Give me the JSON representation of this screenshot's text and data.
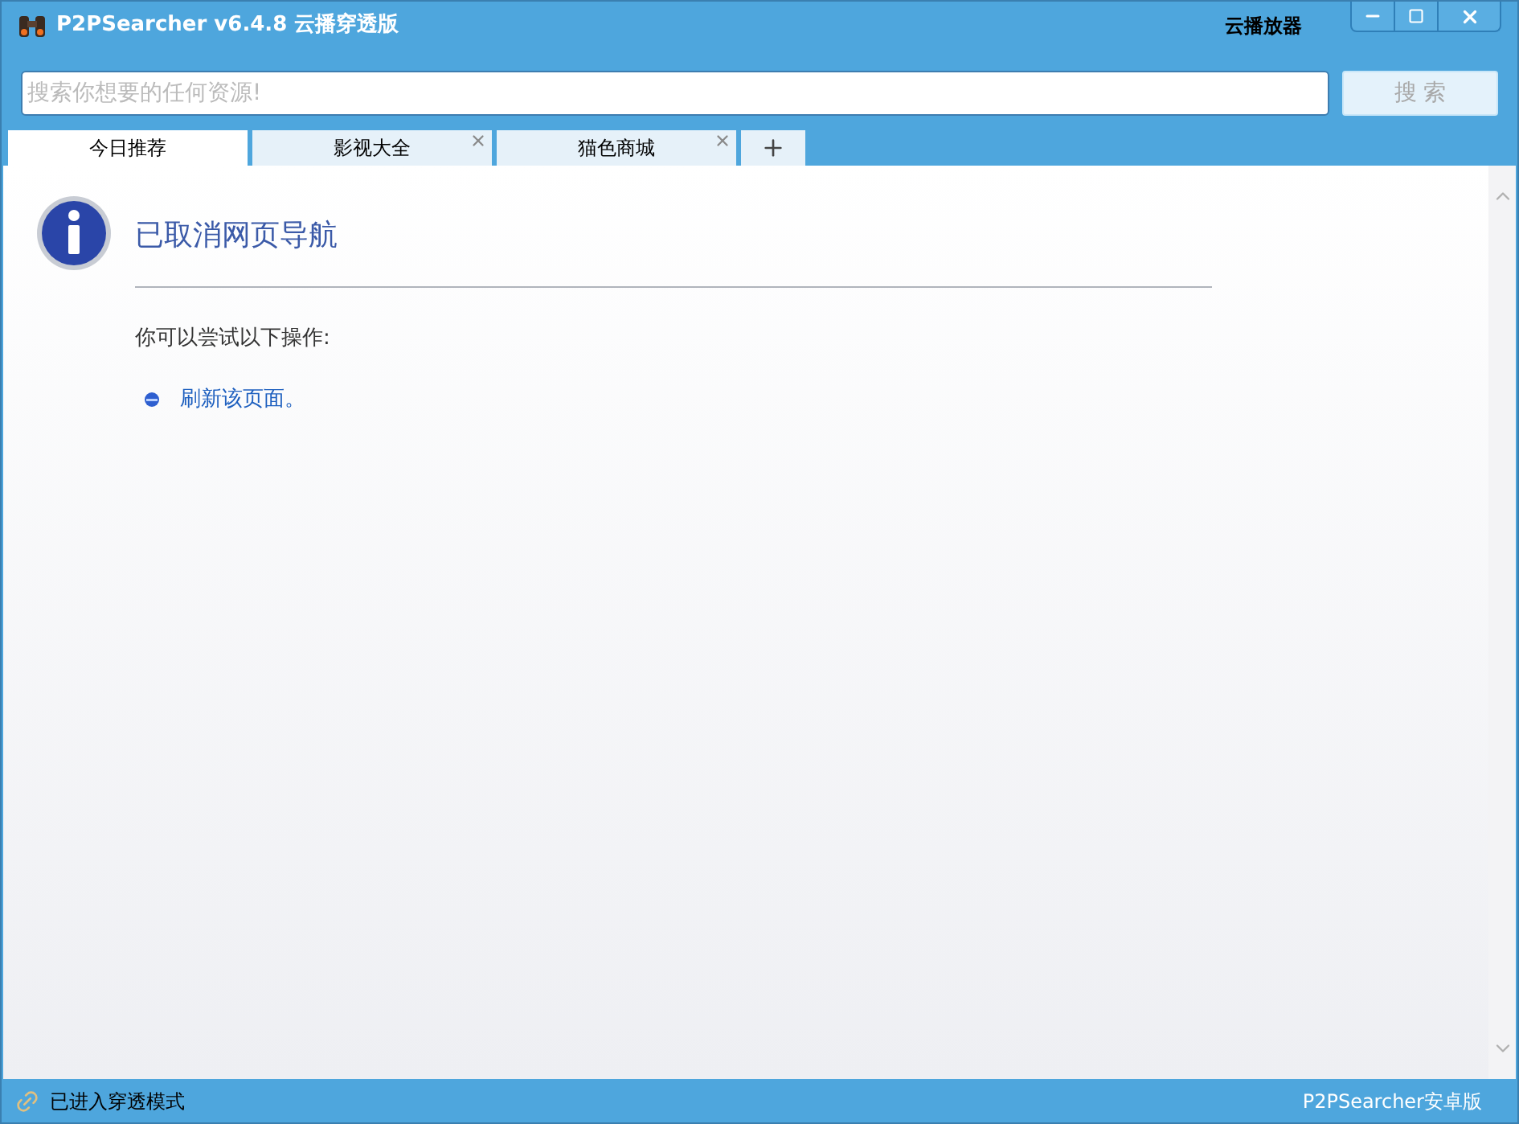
{
  "window": {
    "title": "P2PSearcher v6.4.8 云播穿透版",
    "player_link": "云播放器"
  },
  "search": {
    "placeholder": "搜索你想要的任何资源!",
    "button": "搜 索"
  },
  "tabs": [
    {
      "label": "今日推荐",
      "selected": true,
      "closable": false
    },
    {
      "label": "影视大全",
      "selected": false,
      "closable": true
    },
    {
      "label": "猫色商城",
      "selected": false,
      "closable": true
    }
  ],
  "page": {
    "heading": "已取消网页导航",
    "intro": "你可以尝试以下操作:",
    "actions": [
      "刷新该页面。"
    ]
  },
  "status_bar": {
    "left": "已进入穿透模式",
    "right": "P2PSearcher安卓版"
  }
}
